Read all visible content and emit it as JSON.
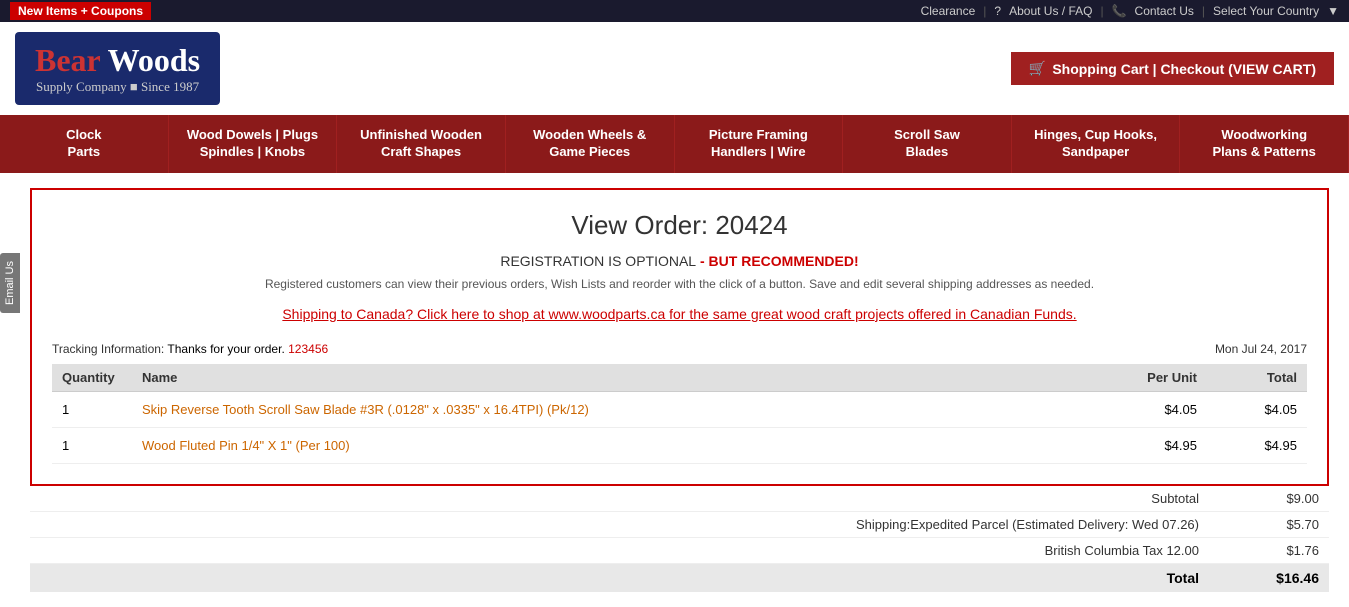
{
  "topbar": {
    "new_items_label": "New Items + Coupons",
    "clearance": "Clearance",
    "about_faq": "About Us / FAQ",
    "contact_us": "Contact Us",
    "select_country": "Select Your Country"
  },
  "header": {
    "logo_bear": "Bear",
    "logo_woods": " Woods",
    "logo_subtitle": "Supply Company ■ Since 1987",
    "cart_label": "Shopping Cart | Checkout (VIEW CART)"
  },
  "nav": {
    "items": [
      {
        "label": "Clock\nParts"
      },
      {
        "label": "Wood Dowels | Plugs\nSpindles | Knobs"
      },
      {
        "label": "Unfinished Wooden\nCraft Shapes"
      },
      {
        "label": "Wooden Wheels &\nGame Pieces"
      },
      {
        "label": "Picture Framing\nHandlers | Wire"
      },
      {
        "label": "Scroll Saw\nBlades"
      },
      {
        "label": "Hinges, Cup Hooks,\nSandpaper"
      },
      {
        "label": "Woodworking\nPlans & Patterns"
      }
    ]
  },
  "email_tab": "Email Us",
  "order": {
    "title": "View Order: 20424",
    "reg_optional": "REGISTRATION IS OPTIONAL",
    "reg_recommended": " - BUT RECOMMENDED!",
    "reg_desc": "Registered customers can view their previous orders, Wish Lists and reorder with the click of a button. Save and edit several shipping addresses as needed.",
    "canada_notice": "Shipping to Canada? Click here to shop at www.woodparts.ca for the same great wood craft projects offered in Canadian Funds.",
    "tracking_label": "Tracking Information:",
    "tracking_text": "Thanks for your order.",
    "tracking_link": "123456",
    "order_date": "Mon Jul 24, 2017",
    "table_headers": {
      "quantity": "Quantity",
      "name": "Name",
      "per_unit": "Per Unit",
      "total": "Total"
    },
    "items": [
      {
        "quantity": "1",
        "name": "Skip Reverse Tooth Scroll Saw Blade #3R (.0128\" x .0335\" x 16.4TPI) (Pk/12)",
        "per_unit": "$4.05",
        "total": "$4.05"
      },
      {
        "quantity": "1",
        "name": "Wood Fluted Pin 1/4\" X 1\" (Per 100)",
        "per_unit": "$4.95",
        "total": "$4.95"
      }
    ],
    "summary": {
      "subtotal_label": "Subtotal",
      "subtotal_value": "$9.00",
      "shipping_label": "Shipping:Expedited Parcel (Estimated Delivery: Wed 07.26)",
      "shipping_value": "$5.70",
      "tax_label": "British Columbia Tax 12.00",
      "tax_value": "$1.76",
      "total_label": "Total",
      "total_value": "$16.46"
    }
  }
}
